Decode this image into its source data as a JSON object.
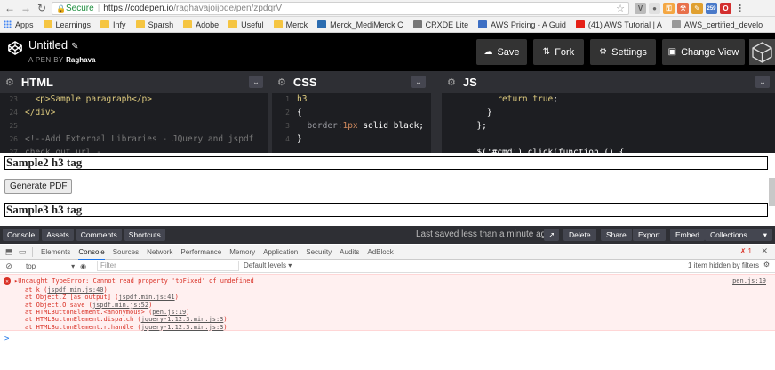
{
  "browser": {
    "secure_label": "Secure",
    "url_host": "https://codepen.io",
    "url_path": "/raghavajoijode/pen/zpdqrV",
    "bookmarks": [
      {
        "label": "Apps",
        "icon": "apps-grid-icon"
      },
      {
        "label": "Learnings",
        "icon": "folder-icon"
      },
      {
        "label": "Infy",
        "icon": "folder-icon"
      },
      {
        "label": "Sparsh",
        "icon": "folder-icon"
      },
      {
        "label": "Adobe",
        "icon": "folder-icon"
      },
      {
        "label": "Useful",
        "icon": "folder-icon"
      },
      {
        "label": "Merck",
        "icon": "folder-icon"
      },
      {
        "label": "Merck_MediMerck C",
        "icon": "merck-x-icon"
      },
      {
        "label": "CRXDE Lite",
        "icon": "crxde-gear-icon"
      },
      {
        "label": "AWS Pricing - A Guid",
        "icon": "e-icon"
      },
      {
        "label": "(41) AWS Tutorial | A",
        "icon": "youtube-icon"
      },
      {
        "label": "AWS_certified_develo",
        "icon": "page-icon"
      }
    ],
    "ext_badge": "259"
  },
  "header": {
    "title": "Untitled",
    "byline_prefix": "A PEN BY",
    "author": "Raghava",
    "save_label": "Save",
    "fork_label": "Fork",
    "settings_label": "Settings",
    "change_view_label": "Change View"
  },
  "editors": {
    "html": {
      "title": "HTML",
      "lines": [
        {
          "num": "23",
          "text": "  <p>Sample paragraph</p>"
        },
        {
          "num": "24",
          "text": "</div>"
        },
        {
          "num": "25",
          "text": ""
        },
        {
          "num": "26",
          "text": "<!--Add External Libraries - JQuery and jspdf"
        },
        {
          "num": "27",
          "text": "check out url -"
        }
      ]
    },
    "css": {
      "title": "CSS",
      "lines": [
        {
          "num": "1",
          "text": "h3"
        },
        {
          "num": "2",
          "text": "{"
        },
        {
          "num": "3",
          "text": "  border:1px solid black;"
        },
        {
          "num": "4",
          "text": "}"
        }
      ]
    },
    "js": {
      "title": "JS",
      "lines": [
        {
          "num": "",
          "text": "      return true;"
        },
        {
          "num": "",
          "text": "    }"
        },
        {
          "num": "",
          "text": "  };"
        },
        {
          "num": "",
          "text": ""
        },
        {
          "num": "",
          "text": "  $('#cmd').click(function () {"
        }
      ]
    }
  },
  "preview": {
    "h3_first": "Sample2 h3 tag",
    "button_label": "Generate PDF",
    "h3_second": "Sample3 h3 tag"
  },
  "bottom_bar": {
    "console_label": "Console",
    "assets_label": "Assets",
    "comments_label": "Comments",
    "shortcuts_label": "Shortcuts",
    "saved_status": "Last saved less than a minute ago",
    "delete_label": "Delete",
    "share_label": "Share",
    "export_label": "Export",
    "embed_label": "Embed",
    "collections_label": "Collections"
  },
  "devtools": {
    "tabs": [
      "Elements",
      "Console",
      "Sources",
      "Network",
      "Performance",
      "Memory",
      "Application",
      "Security",
      "Audits",
      "AdBlock"
    ],
    "active_tab": "Console",
    "error_count": "1",
    "context": "top",
    "filter_placeholder": "Filter",
    "levels_label": "Default levels",
    "hidden_info": "1 item hidden by filters",
    "error": {
      "message": "Uncaught TypeError: Cannot read property 'toFixed' of undefined",
      "source": "pen.js:19",
      "stack": [
        {
          "prefix": "at k (",
          "link": "jspdf.min.js:40",
          "suffix": ")"
        },
        {
          "prefix": "at Object.Z [as output] (",
          "link": "jspdf.min.js:41",
          "suffix": ")"
        },
        {
          "prefix": "at Object.O.save (",
          "link": "jspdf.min.js:52",
          "suffix": ")"
        },
        {
          "prefix": "at HTMLButtonElement.<anonymous> (",
          "link": "pen.js:19",
          "suffix": ")"
        },
        {
          "prefix": "at HTMLButtonElement.dispatch (",
          "link": "jquery-1.12.3.min.js:3",
          "suffix": ")"
        },
        {
          "prefix": "at HTMLButtonElement.r.handle (",
          "link": "jquery-1.12.3.min.js:3",
          "suffix": ")"
        }
      ]
    },
    "prompt_symbol": ">"
  },
  "colors": {
    "codepen_black": "#000000",
    "editor_bg": "#1d1e22",
    "error_red": "#d93025",
    "secure_green": "#1e8e3e"
  }
}
